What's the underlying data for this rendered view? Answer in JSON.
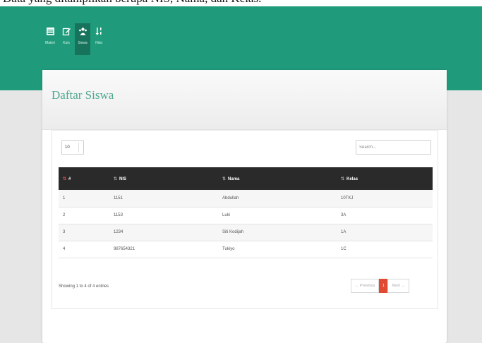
{
  "caption": "Data yang ditampilkan berupa NIS, Nama, dan Kelas.",
  "colors": {
    "topbar": "#1f9b7b",
    "title": "#4ea891",
    "table_head": "#2a2a2a",
    "active_page": "#e04a33"
  },
  "nav": {
    "items": [
      {
        "label": "Materi",
        "icon": "table-icon"
      },
      {
        "label": "Kuis",
        "icon": "edit-icon"
      },
      {
        "label": "Siswa",
        "icon": "users-icon"
      },
      {
        "label": "Nilai",
        "icon": "sort-icon"
      }
    ]
  },
  "page": {
    "title": "Daftar Siswa"
  },
  "length_value": "10",
  "search": {
    "placeholder": "Search..."
  },
  "table": {
    "headers": [
      "#",
      "NIS",
      "Nama",
      "Kelas"
    ],
    "rows": [
      [
        "1",
        "1151",
        "Abdullah",
        "10TKJ"
      ],
      [
        "2",
        "1153",
        "Luki",
        "3A"
      ],
      [
        "3",
        "1234",
        "Siti Kodijah",
        "1A"
      ],
      [
        "4",
        "987654321",
        "Tukiyo",
        "1C"
      ]
    ]
  },
  "info": "Showing 1 to 4 of 4 entries",
  "pagination": {
    "previous": "← Previous",
    "current": "1",
    "next": "Next →"
  }
}
